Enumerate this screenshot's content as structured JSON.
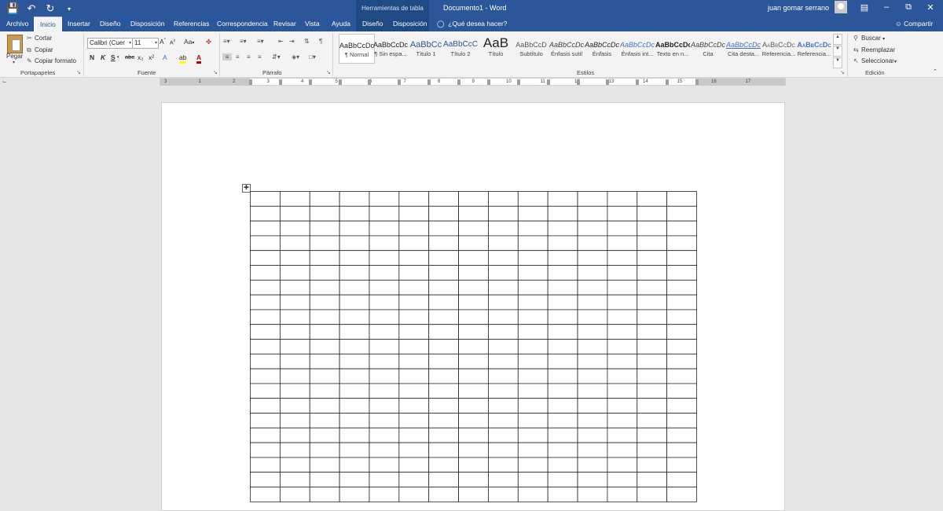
{
  "window": {
    "doc_title": "Documento1  -  Word",
    "context_label": "Herramientas de tabla",
    "user_name": "juan gomar serrano",
    "accent": "#2b579a"
  },
  "qat": {
    "save_icon": "save-icon",
    "undo_icon": "undo-icon",
    "redo_icon": "redo-icon",
    "customize_icon": "customize-qat-icon"
  },
  "tabs": [
    "Archivo",
    "Inicio",
    "Insertar",
    "Diseño",
    "Disposición",
    "Referencias",
    "Correspondencia",
    "Revisar",
    "Vista",
    "Ayuda",
    "Diseño",
    "Disposición"
  ],
  "active_tab": "Inicio",
  "tell_me": "¿Qué desea hacer?",
  "share": "Compartir",
  "clipboard": {
    "paste": "Pegar",
    "cut": "Cortar",
    "copy": "Copiar",
    "format_painter": "Copiar formato",
    "group": "Portapapeles"
  },
  "font": {
    "family": "Calibri (Cuer",
    "size": "11",
    "case_btn": "Aa",
    "bold": "N",
    "italic": "K",
    "underline": "S",
    "strike": "abc",
    "subscript": "x₂",
    "superscript": "x²",
    "group": "Fuente"
  },
  "paragraph": {
    "group": "Párrafo"
  },
  "styles": {
    "group": "Estilos",
    "items": [
      {
        "sample": "AaBbCcDc",
        "name": "¶ Normal"
      },
      {
        "sample": "AaBbCcDc",
        "name": "¶ Sin espa..."
      },
      {
        "sample": "AaBbCc",
        "name": "Título 1"
      },
      {
        "sample": "AaBbCcC",
        "name": "Título 2"
      },
      {
        "sample": "AaB",
        "name": "Título"
      },
      {
        "sample": "AaBbCcD",
        "name": "Subtítulo"
      },
      {
        "sample": "AaBbCcDc",
        "name": "Énfasis sutil"
      },
      {
        "sample": "AaBbCcDc",
        "name": "Énfasis"
      },
      {
        "sample": "AaBbCcDc",
        "name": "Énfasis int..."
      },
      {
        "sample": "AaBbCcDc",
        "name": "Texto en n..."
      },
      {
        "sample": "AaBbCcDc",
        "name": "Cita"
      },
      {
        "sample": "AaBbCcDc",
        "name": "Cita desta..."
      },
      {
        "sample": "AaBbCcDc",
        "name": "Referencia..."
      },
      {
        "sample": "AaBbCcDc",
        "name": "Referencia..."
      }
    ]
  },
  "editing": {
    "find": "Buscar",
    "replace": "Reemplazar",
    "select": "Seleccionar",
    "group": "Edición"
  },
  "ruler": {
    "numbers": [
      "3",
      "1",
      "2",
      "3",
      "4",
      "5",
      "6",
      "7",
      "8",
      "9",
      "10",
      "11",
      "12",
      "13",
      "14",
      "15",
      "16",
      "17"
    ]
  },
  "table": {
    "columns": 15,
    "visible_rows": 21
  }
}
